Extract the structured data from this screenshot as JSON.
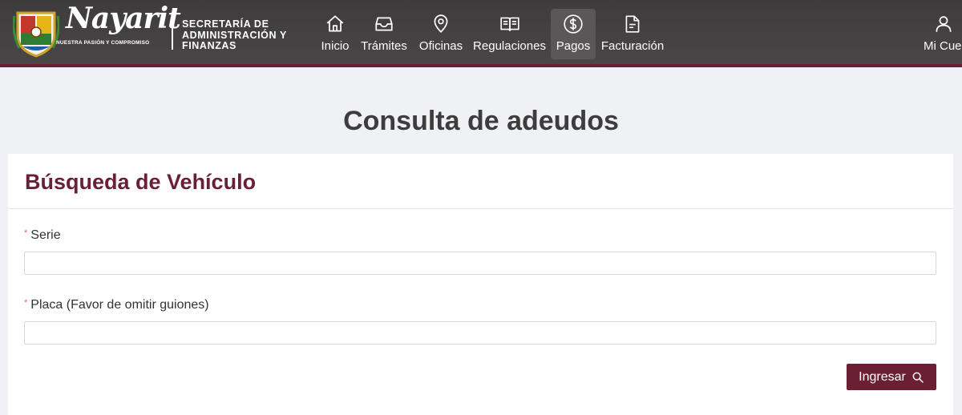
{
  "header": {
    "logo_text": "Nayarit",
    "logo_tagline": "NUESTRA PASIÓN Y COMPROMISO",
    "department_lines": [
      "SECRETARÍA DE",
      "ADMINISTRACIÓN Y",
      "FINANZAS"
    ],
    "nav": [
      {
        "label": "Inicio",
        "icon": "home-icon"
      },
      {
        "label": "Trámites",
        "icon": "inbox-icon"
      },
      {
        "label": "Oficinas",
        "icon": "location-pin-icon"
      },
      {
        "label": "Regulaciones",
        "icon": "book-icon"
      },
      {
        "label": "Pagos",
        "icon": "dollar-circle-icon",
        "active": true
      },
      {
        "label": "Facturación",
        "icon": "document-icon"
      }
    ],
    "account_label": "Mi Cuenta",
    "account_icon": "user-icon"
  },
  "page": {
    "title": "Consulta de adeudos"
  },
  "form": {
    "title": "Búsqueda de Vehículo",
    "required_marker": "*",
    "fields": [
      {
        "label": "Serie",
        "value": "",
        "placeholder": ""
      },
      {
        "label": "Placa (Favor de omitir guiones)",
        "value": "",
        "placeholder": ""
      }
    ],
    "submit_label": "Ingresar",
    "submit_icon": "search-icon"
  },
  "colors": {
    "header_bg": "#454142",
    "accent": "#6b1f35",
    "page_bg": "#f0f1f5",
    "required": "#e06060"
  }
}
